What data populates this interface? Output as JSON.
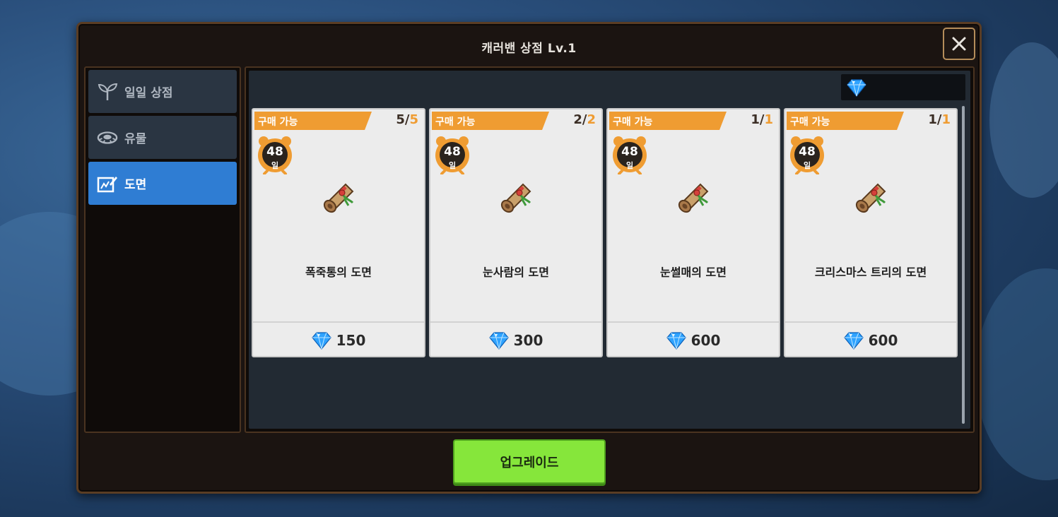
{
  "window": {
    "title": "캐러밴 상점 Lv.1"
  },
  "sidebar": {
    "items": [
      {
        "label": "일일 상점",
        "icon": "sprout-icon",
        "active": false
      },
      {
        "label": "유물",
        "icon": "relic-icon",
        "active": false
      },
      {
        "label": "도면",
        "icon": "blueprint-icon",
        "active": true
      }
    ]
  },
  "currency": {
    "icon": "diamond-icon",
    "value": ""
  },
  "shop": {
    "items": [
      {
        "badge": "구매 가능",
        "remaining": "5",
        "max": "5",
        "timer_days": "48",
        "timer_unit": "일",
        "icon": "scroll-icon",
        "name": "폭죽통의 도면",
        "price": "150",
        "price_icon": "diamond-icon"
      },
      {
        "badge": "구매 가능",
        "remaining": "2",
        "max": "2",
        "timer_days": "48",
        "timer_unit": "일",
        "icon": "scroll-icon",
        "name": "눈사람의 도면",
        "price": "300",
        "price_icon": "diamond-icon"
      },
      {
        "badge": "구매 가능",
        "remaining": "1",
        "max": "1",
        "timer_days": "48",
        "timer_unit": "일",
        "icon": "scroll-icon",
        "name": "눈썰매의 도면",
        "price": "600",
        "price_icon": "diamond-icon"
      },
      {
        "badge": "구매 가능",
        "remaining": "1",
        "max": "1",
        "timer_days": "48",
        "timer_unit": "일",
        "icon": "scroll-icon",
        "name": "크리스마스 트리의 도면",
        "price": "600",
        "price_icon": "diamond-icon"
      }
    ]
  },
  "footer": {
    "upgrade_label": "업그레이드"
  },
  "colors": {
    "accent_orange": "#ef9c32",
    "active_tab": "#2f7dd3",
    "upgrade_green": "#86e63b",
    "diamond": "#2fa3ff"
  }
}
